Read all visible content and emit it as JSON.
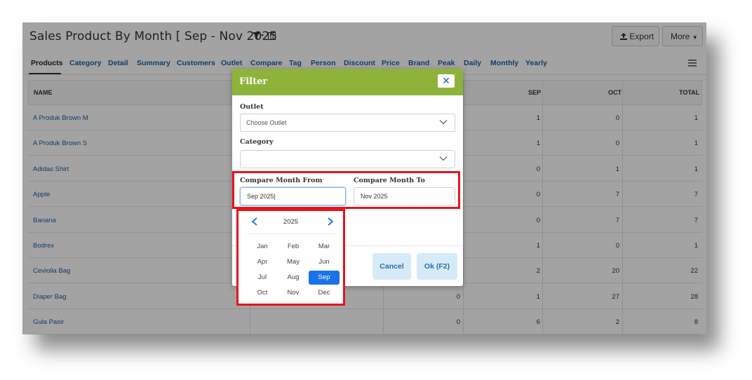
{
  "header": {
    "title": "Sales Product By Month [ Sep - Nov 2025",
    "filter_icon": "filter-icon",
    "columns_icon": "columns-icon",
    "export_label": "Export",
    "more_label": "More"
  },
  "tabs": [
    "Products",
    "Category",
    "Detail",
    "Summary",
    "Customers",
    "Outlet",
    "Compare",
    "Tag",
    "Person",
    "Discount",
    "Price",
    "Brand",
    "Peak",
    "Daily",
    "Monthly",
    "Yearly"
  ],
  "table": {
    "headers": {
      "name": "NAME",
      "sep": "SEP",
      "oct": "OCT",
      "total": "TOTAL"
    },
    "rows": [
      {
        "name": "A Produk Brown M",
        "mid": "",
        "sep": "1",
        "oct": "0",
        "total": "1"
      },
      {
        "name": "A Produk Brown S",
        "mid": "",
        "sep": "1",
        "oct": "0",
        "total": "1"
      },
      {
        "name": "Adidas Shirt",
        "mid": "",
        "sep": "0",
        "oct": "1",
        "total": "1"
      },
      {
        "name": "Apple",
        "mid": "",
        "sep": "0",
        "oct": "7",
        "total": "7"
      },
      {
        "name": "Banana",
        "mid": "",
        "sep": "0",
        "oct": "7",
        "total": "7"
      },
      {
        "name": "Bodrex",
        "mid": "",
        "sep": "1",
        "oct": "0",
        "total": "1"
      },
      {
        "name": "Ceviolla Bag",
        "mid": "",
        "sep": "2",
        "oct": "20",
        "total": "22"
      },
      {
        "name": "Diaper Bag",
        "mid": "0",
        "sep": "1",
        "oct": "27",
        "total": "28"
      },
      {
        "name": "Gula Pasir",
        "mid": "0",
        "sep": "6",
        "oct": "2",
        "total": "8"
      }
    ]
  },
  "modal": {
    "title": "Filter",
    "outlet_label": "Outlet",
    "outlet_placeholder": "Choose Outlet",
    "category_label": "Category",
    "category_value": "",
    "from_label": "Compare Month From",
    "from_value": "Sep 2025",
    "to_label": "Compare Month To",
    "to_value": "Nov 2025",
    "cancel_label": "Cancel",
    "ok_label": "Ok (F2)"
  },
  "picker": {
    "year": "2025",
    "months": [
      "Jan",
      "Feb",
      "Mar",
      "Apr",
      "May",
      "Jun",
      "Jul",
      "Aug",
      "Sep",
      "Oct",
      "Nov",
      "Dec"
    ],
    "selected": "Sep"
  },
  "colors": {
    "accent": "#8db33a",
    "link": "#1f5f9e",
    "highlight": "#e8141b",
    "selected": "#1a73e8"
  }
}
